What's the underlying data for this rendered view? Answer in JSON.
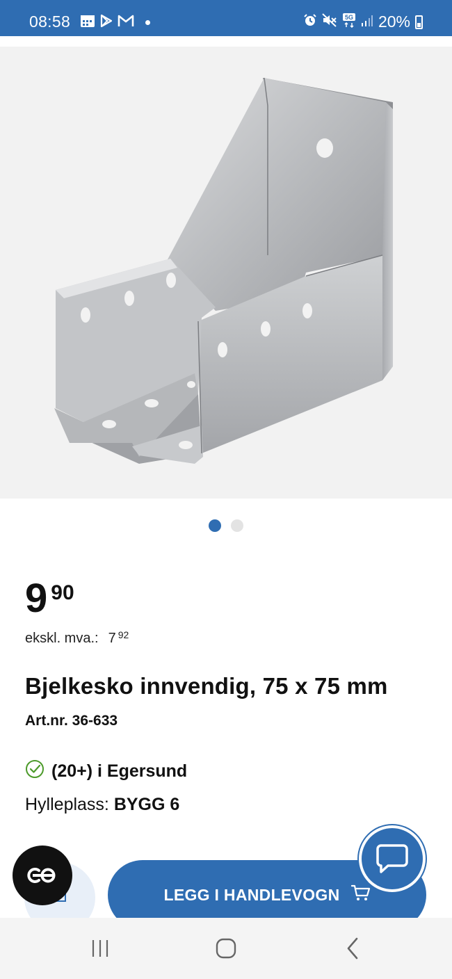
{
  "status_bar": {
    "time": "08:58",
    "network": "5G",
    "battery": "20%",
    "icons": [
      "calendar-icon",
      "play-store-icon",
      "gmail-icon",
      "alarm-icon",
      "mute-icon",
      "5g-icon",
      "signal-icon",
      "battery-icon"
    ]
  },
  "carousel": {
    "count": 2,
    "active": 0
  },
  "product": {
    "price_main": "9",
    "price_cents": "90",
    "ex_vat_label": "ekskl. mva.:",
    "ex_vat_main": "7",
    "ex_vat_cents": "92",
    "title": "Bjelkesko innvendig, 75 x 75 mm",
    "article_number": "Art.nr. 36-633"
  },
  "availability": {
    "stock_text": "(20+) i Egersund",
    "shelf_label": "Hylleplass:",
    "shelf_value": "BYGG 6"
  },
  "actions": {
    "cart_button_label": "LEGG I HANDLEVOGN",
    "co_button_label": "CO"
  },
  "colors": {
    "brand_blue": "#2f6db2",
    "stock_green": "#4c9a2a",
    "dark": "#111111"
  }
}
